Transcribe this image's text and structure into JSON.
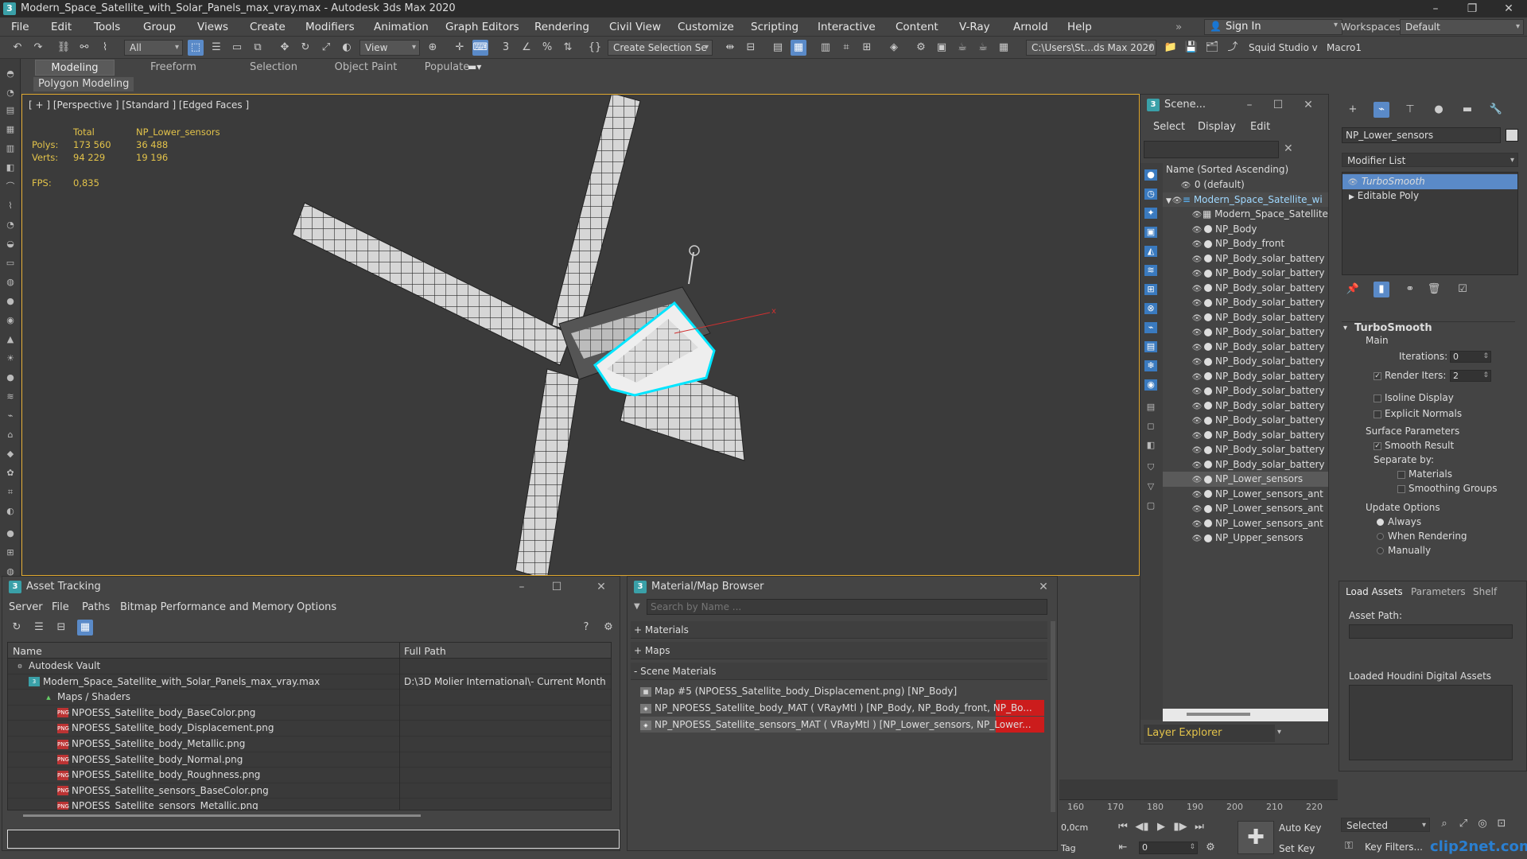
{
  "window": {
    "title": "Modern_Space_Satellite_with_Solar_Panels_max_vray.max - Autodesk 3ds Max 2020",
    "app_icon": "3"
  },
  "menu": [
    "File",
    "Edit",
    "Tools",
    "Group",
    "Views",
    "Create",
    "Modifiers",
    "Animation",
    "Graph Editors",
    "Rendering",
    "Civil View",
    "Customize",
    "Scripting",
    "Interactive",
    "Content",
    "V-Ray",
    "Arnold",
    "Help"
  ],
  "account": {
    "sign_in": "Sign In",
    "workspaces_label": "Workspaces:",
    "workspace_value": "Default"
  },
  "toolbar": {
    "filter_value": "All",
    "refcoord_value": "View",
    "selection_set_value": "Create Selection Se",
    "path_value": "C:\\Users\\St...ds Max 2020",
    "squid": "Squid Studio v",
    "macro": "Macro1"
  },
  "ribbon": {
    "tabs": [
      "Modeling",
      "Freeform",
      "Selection",
      "Object Paint",
      "Populate"
    ],
    "active": "Modeling",
    "sub_label": "Polygon Modeling"
  },
  "viewport": {
    "label": "[ + ] [Perspective ] [Standard ] [Edged Faces ]",
    "stats": {
      "col_total": "Total",
      "col_object": "NP_Lower_sensors",
      "polys_label": "Polys:",
      "polys_total": "173 560",
      "polys_obj": "36 488",
      "verts_label": "Verts:",
      "verts_total": "94 229",
      "verts_obj": "19 196",
      "fps_label": "FPS:",
      "fps_value": "0,835"
    }
  },
  "scene_explorer": {
    "title": "Scene...",
    "menu": [
      "Select",
      "Display",
      "Edit"
    ],
    "column_header": "Name (Sorted Ascending)",
    "rows": [
      "0 (default)",
      "Modern_Space_Satellite_wi",
      "Modern_Space_Satellite",
      "NP_Body",
      "NP_Body_front",
      "NP_Body_solar_battery",
      "NP_Body_solar_battery",
      "NP_Body_solar_battery",
      "NP_Body_solar_battery",
      "NP_Body_solar_battery",
      "NP_Body_solar_battery",
      "NP_Body_solar_battery",
      "NP_Body_solar_battery",
      "NP_Body_solar_battery",
      "NP_Body_solar_battery",
      "NP_Body_solar_battery",
      "NP_Body_solar_battery",
      "NP_Body_solar_battery",
      "NP_Body_solar_battery",
      "NP_Body_solar_battery",
      "NP_Lower_sensors",
      "NP_Lower_sensors_ant",
      "NP_Lower_sensors_ant",
      "NP_Lower_sensors_ant",
      "NP_Upper_sensors"
    ],
    "footer": "Layer Explorer"
  },
  "command_panel": {
    "object_name": "NP_Lower_sensors",
    "modifier_list": "Modifier List",
    "stack": [
      "TurboSmooth",
      "Editable Poly"
    ],
    "turbosmooth": {
      "title": "TurboSmooth",
      "main": "Main",
      "iterations_label": "Iterations:",
      "iterations_value": "0",
      "render_iters_label": "Render Iters:",
      "render_iters_value": "2",
      "isoline": "Isoline Display",
      "explicit": "Explicit Normals",
      "surface": "Surface Parameters",
      "smooth_result": "Smooth Result",
      "separate_by": "Separate by:",
      "materials": "Materials",
      "smoothing_groups": "Smoothing Groups",
      "update_options": "Update Options",
      "always": "Always",
      "when_rendering": "When Rendering",
      "manually": "Manually"
    }
  },
  "assets_panel": {
    "tabs": [
      "Load Assets",
      "Parameters",
      "Shelf"
    ],
    "asset_path": "Asset Path:",
    "loaded": "Loaded Houdini Digital Assets"
  },
  "asset_tracking": {
    "title": "Asset Tracking",
    "menu": [
      "Server",
      "File",
      "Paths",
      "Bitmap Performance and Memory",
      "Options"
    ],
    "col_name": "Name",
    "col_path": "Full Path",
    "rows": [
      {
        "name": "Autodesk Vault",
        "path": "",
        "indent": 0,
        "kind": "vault"
      },
      {
        "name": "Modern_Space_Satellite_with_Solar_Panels_max_vray.max",
        "path": "D:\\3D Molier International\\- Current Month",
        "indent": 1,
        "kind": "max"
      },
      {
        "name": "Maps / Shaders",
        "path": "",
        "indent": 2,
        "kind": "maps"
      },
      {
        "name": "NPOESS_Satellite_body_BaseColor.png",
        "path": "",
        "indent": 3,
        "kind": "png"
      },
      {
        "name": "NPOESS_Satellite_body_Displacement.png",
        "path": "",
        "indent": 3,
        "kind": "png"
      },
      {
        "name": "NPOESS_Satellite_body_Metallic.png",
        "path": "",
        "indent": 3,
        "kind": "png"
      },
      {
        "name": "NPOESS_Satellite_body_Normal.png",
        "path": "",
        "indent": 3,
        "kind": "png"
      },
      {
        "name": "NPOESS_Satellite_body_Roughness.png",
        "path": "",
        "indent": 3,
        "kind": "png"
      },
      {
        "name": "NPOESS_Satellite_sensors_BaseColor.png",
        "path": "",
        "indent": 3,
        "kind": "png"
      },
      {
        "name": "NPOESS_Satellite_sensors_Metallic.png",
        "path": "",
        "indent": 3,
        "kind": "png"
      }
    ]
  },
  "material_browser": {
    "title": "Material/Map Browser",
    "search_placeholder": "Search by Name ...",
    "groups": [
      "+ Materials",
      "+ Maps",
      "- Scene Materials"
    ],
    "items": [
      "Map #5 (NPOESS_Satellite_body_Displacement.png) [NP_Body]",
      "NP_NPOESS_Satellite_body_MAT ( VRayMtl ) [NP_Body, NP_Body_front, NP_Bo...",
      "NP_NPOESS_Satellite_sensors_MAT ( VRayMtl ) [NP_Lower_sensors, NP_Lower..."
    ]
  },
  "timeline": {
    "ticks": [
      "160",
      "170",
      "180",
      "190",
      "200",
      "210",
      "220"
    ],
    "coord_label": "0,0cm",
    "tag_label": "Tag",
    "frame_value": "0",
    "auto_key": "Auto Key",
    "set_key": "Set Key",
    "selected": "Selected",
    "key_filters": "Key Filters...",
    "watermark": "clip2net.com"
  },
  "colors": {
    "accent": "#5a8ac8",
    "selection": "#00e5ff",
    "viewport_border": "#e0a82e",
    "stats": "#e3c34a",
    "material_red": "#cc1c1c"
  }
}
